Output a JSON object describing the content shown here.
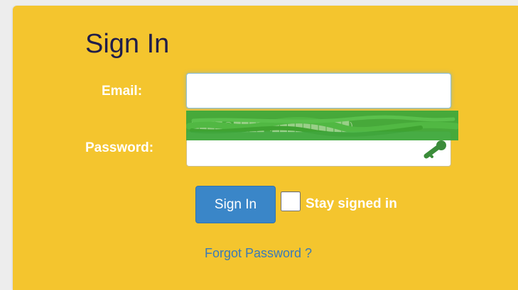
{
  "form": {
    "title": "Sign In",
    "email_label": "Email:",
    "email_value": "",
    "password_label": "Password:",
    "password_value": "",
    "autofill_suggestion": "████@████ (██████████)",
    "submit_label": "Sign In",
    "stay_signed_in_label": "Stay signed in",
    "stay_signed_in_checked": false,
    "forgot_password_label": "Forgot Password ?"
  },
  "colors": {
    "panel_background": "#f4c52e",
    "title_color": "#1f1d4a",
    "button_background": "#3a86c8",
    "link_color": "#3a7ab8",
    "autofill_overlay": "#3ea83b"
  },
  "icons": {
    "password_manager": "key-icon"
  }
}
